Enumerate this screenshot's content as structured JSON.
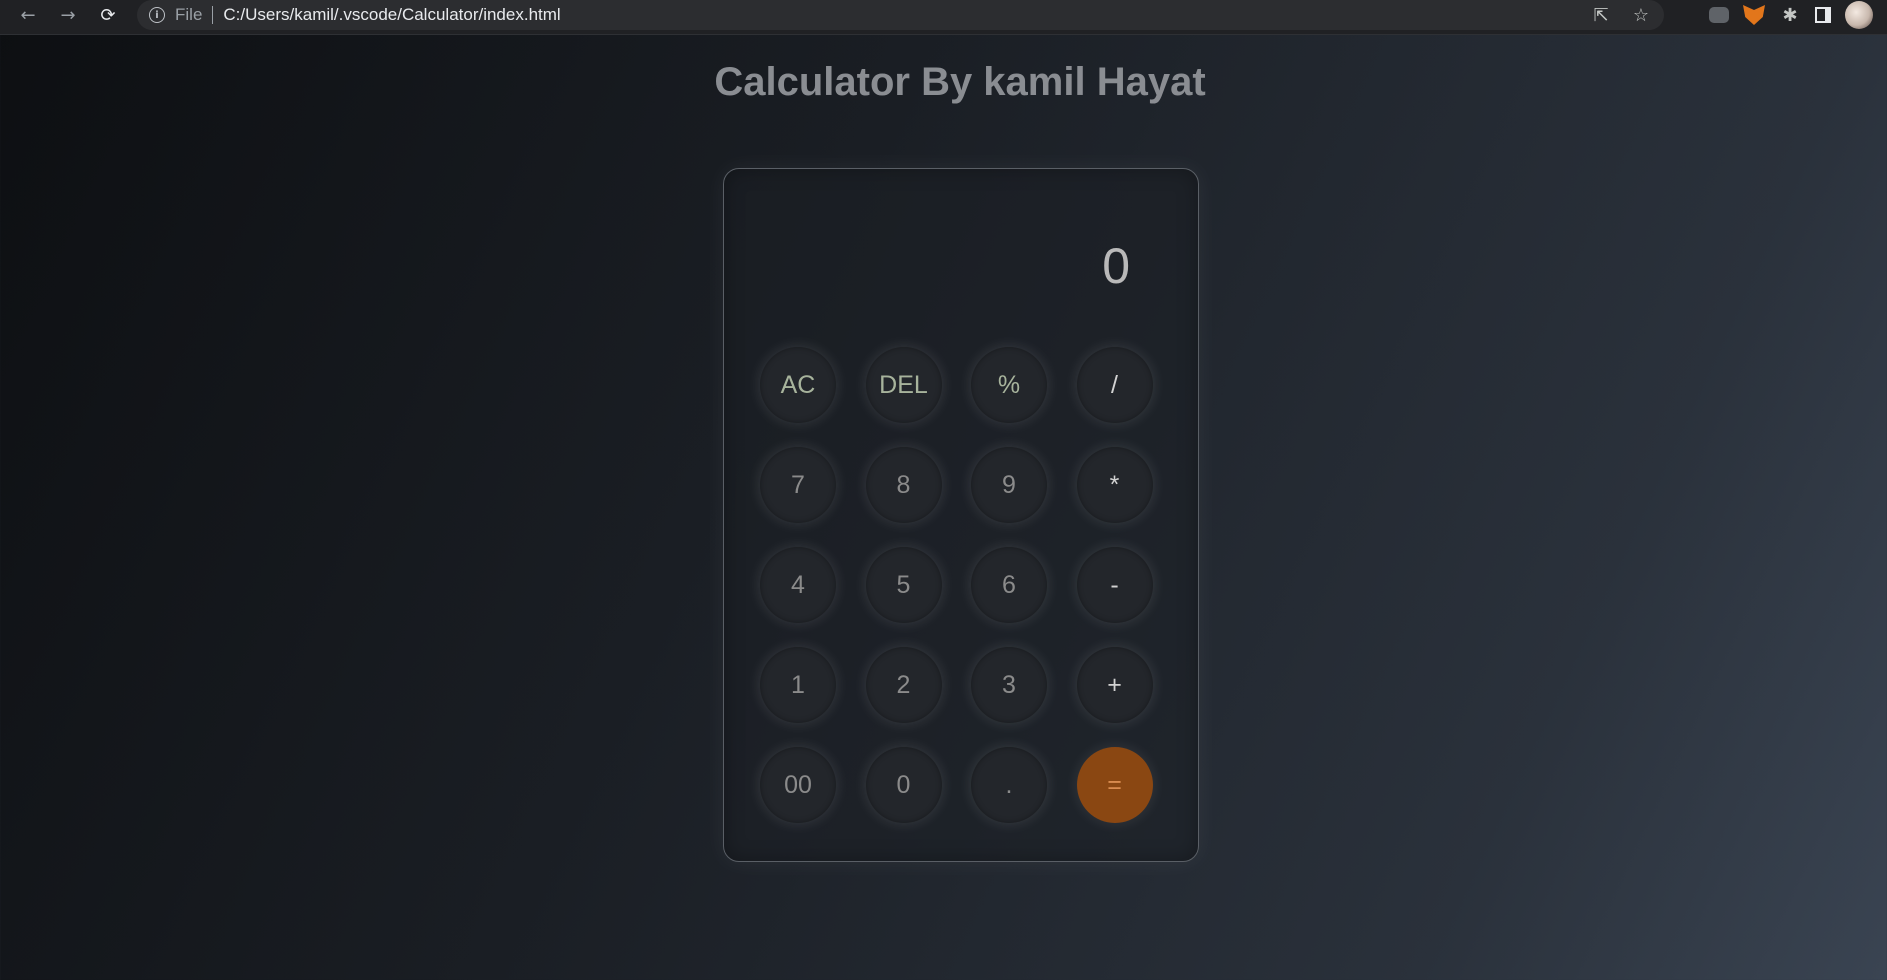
{
  "browser": {
    "back_icon": "arrow-left-icon",
    "forward_icon": "arrow-right-icon",
    "reload_icon": "reload-icon",
    "scheme_label": "File",
    "url": "C:/Users/kamil/.vscode/Calculator/index.html"
  },
  "page": {
    "title": "Calculator By kamil Hayat"
  },
  "calculator": {
    "display_value": "0",
    "keys": [
      {
        "label": "AC",
        "kind": "fn"
      },
      {
        "label": "DEL",
        "kind": "fn"
      },
      {
        "label": "%",
        "kind": "fn"
      },
      {
        "label": "/",
        "kind": "op"
      },
      {
        "label": "7",
        "kind": "num"
      },
      {
        "label": "8",
        "kind": "num"
      },
      {
        "label": "9",
        "kind": "num"
      },
      {
        "label": "*",
        "kind": "op"
      },
      {
        "label": "4",
        "kind": "num"
      },
      {
        "label": "5",
        "kind": "num"
      },
      {
        "label": "6",
        "kind": "num"
      },
      {
        "label": "-",
        "kind": "op"
      },
      {
        "label": "1",
        "kind": "num"
      },
      {
        "label": "2",
        "kind": "num"
      },
      {
        "label": "3",
        "kind": "num"
      },
      {
        "label": "+",
        "kind": "op"
      },
      {
        "label": "00",
        "kind": "num"
      },
      {
        "label": "0",
        "kind": "num"
      },
      {
        "label": ".",
        "kind": "num"
      },
      {
        "label": "=",
        "kind": "eq"
      }
    ]
  },
  "colors": {
    "accent_equals": "#8a4712",
    "background_dark": "#0d0f12",
    "background_light": "#3a4452"
  }
}
